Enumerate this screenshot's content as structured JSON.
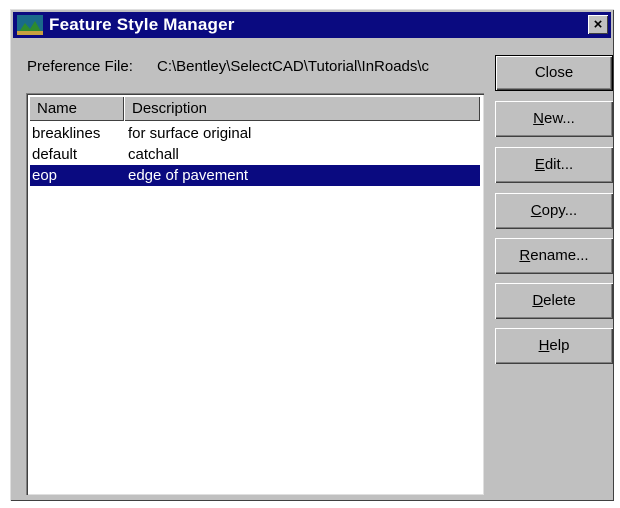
{
  "window": {
    "title": "Feature Style Manager",
    "close_glyph": "×"
  },
  "preference": {
    "label": "Preference File:",
    "value": "C:\\Bentley\\SelectCAD\\Tutorial\\InRoads\\c"
  },
  "list": {
    "columns": [
      "Name",
      "Description"
    ],
    "rows": [
      {
        "name": "breaklines",
        "description": "for surface original",
        "selected": false
      },
      {
        "name": "default",
        "description": "catchall",
        "selected": false
      },
      {
        "name": "eop",
        "description": "edge of pavement",
        "selected": true
      }
    ]
  },
  "buttons": [
    {
      "id": "close",
      "label": "Close",
      "mnemonic_index": -1
    },
    {
      "id": "new",
      "label": "New...",
      "mnemonic_index": 0
    },
    {
      "id": "edit",
      "label": "Edit...",
      "mnemonic_index": 0
    },
    {
      "id": "copy",
      "label": "Copy...",
      "mnemonic_index": 0
    },
    {
      "id": "rename",
      "label": "Rename...",
      "mnemonic_index": 0
    },
    {
      "id": "delete",
      "label": "Delete",
      "mnemonic_index": 0
    },
    {
      "id": "help",
      "label": "Help",
      "mnemonic_index": 0
    }
  ],
  "colors": {
    "titlebar": "#0a0a80",
    "selection": "#0a0a80",
    "face": "#c0c0c0"
  }
}
